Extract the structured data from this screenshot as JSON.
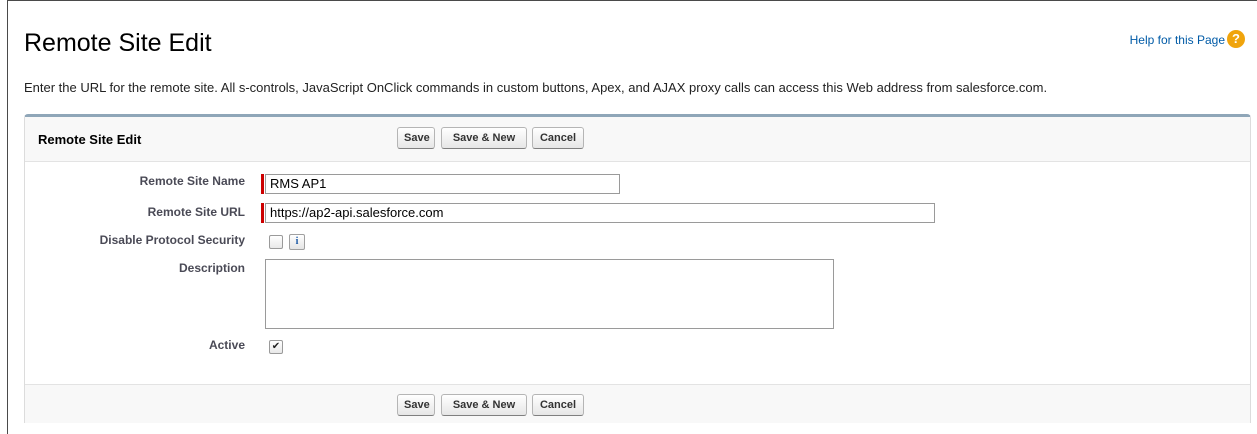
{
  "page": {
    "title": "Remote Site Edit",
    "help_link": "Help for this Page",
    "help_icon": "help-icon",
    "description": "Enter the URL for the remote site. All s-controls, JavaScript OnClick commands in custom buttons, Apex, and AJAX proxy calls can access this Web address from salesforce.com."
  },
  "block": {
    "title": "Remote Site Edit",
    "buttons": {
      "save": "Save",
      "save_new": "Save & New",
      "cancel": "Cancel"
    }
  },
  "fields": {
    "remote_site_name": {
      "label": "Remote Site Name",
      "value": "RMS AP1",
      "required": true
    },
    "remote_site_url": {
      "label": "Remote Site URL",
      "value": "https://ap2-api.salesforce.com",
      "required": true
    },
    "disable_protocol_security": {
      "label": "Disable Protocol Security",
      "checked": false,
      "info_icon": "i"
    },
    "description": {
      "label": "Description",
      "value": ""
    },
    "active": {
      "label": "Active",
      "checked": true
    }
  },
  "colors": {
    "required": "#cc0000",
    "link": "#015ba7",
    "help_icon": "#f0a40c",
    "block_accent": "#8fa6b8"
  }
}
